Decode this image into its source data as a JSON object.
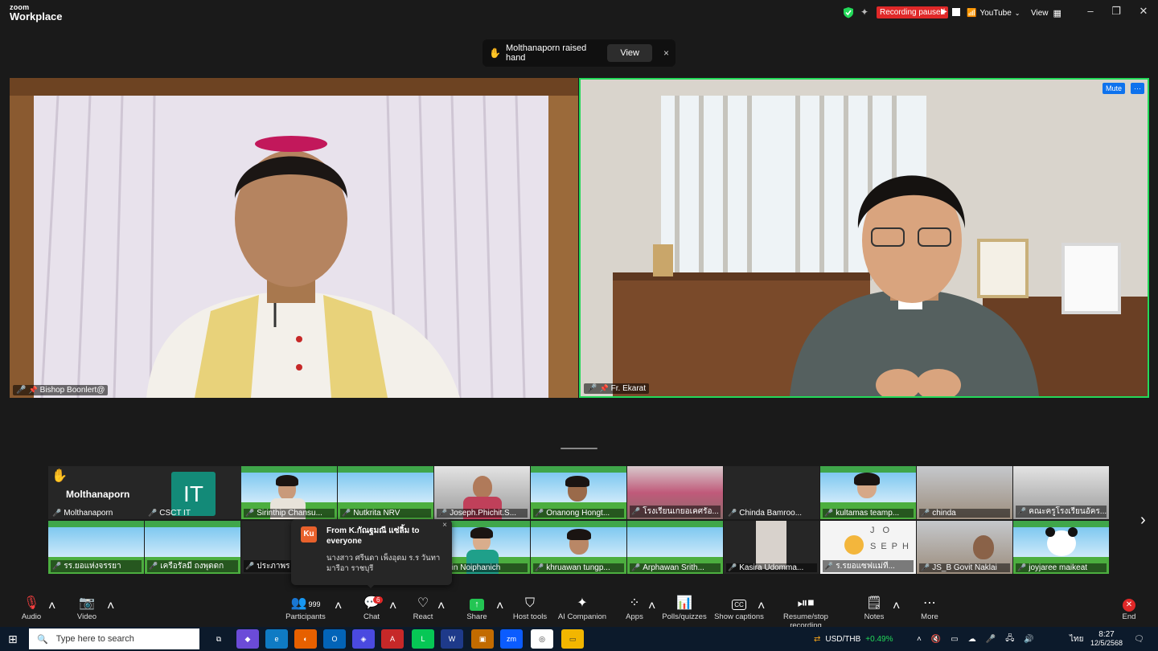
{
  "app": {
    "logo_line1": "zoom",
    "logo_line2": "Workplace"
  },
  "top_right": {
    "recording_status": "Recording paused",
    "youtube_label": "YouTube",
    "view_label": "View"
  },
  "notification": {
    "text": "Molthanaporn raised hand",
    "view_btn": "View",
    "close": "×"
  },
  "speakers": [
    {
      "name": "Bishop Boonlert@"
    },
    {
      "name": "Fr. Ekarat",
      "mute_btn": "Mute",
      "more_btn": "···"
    }
  ],
  "gallery": {
    "row1": [
      {
        "name": "Molthanaporn",
        "big_label": "Molthanaporn",
        "hand": "✋"
      },
      {
        "name": "CSCT IT",
        "avatar_text": "IT"
      },
      {
        "name": "Sirinthip Chansu..."
      },
      {
        "name": "Nutkrita NRV"
      },
      {
        "name": "Joseph.Phichit.S..."
      },
      {
        "name": "Onanong Hongt..."
      },
      {
        "name": "โรงเรียนเกยอเคศรัอ..."
      },
      {
        "name": "Chinda Bamroo..."
      },
      {
        "name": "kultamas teamp..."
      },
      {
        "name": "chinda"
      },
      {
        "name": "คณะครูโรงเรียนอัคร..."
      }
    ],
    "row2": [
      {
        "name": "รร.ยอแห่งจรรยา"
      },
      {
        "name": "เครือรัลมี ถงพุดดก"
      },
      {
        "name": "ประภาพร แ..."
      },
      {
        "name": ""
      },
      {
        "name": "Sailin Noiphanich"
      },
      {
        "name": "khruawan tungp..."
      },
      {
        "name": "Arphawan Srith..."
      },
      {
        "name": "Kasira Udomma..."
      },
      {
        "name": "ร.รยอแซฟแม่ที..."
      },
      {
        "name": "JS_B Govit Naklai"
      },
      {
        "name": "joyjaree maikeat"
      }
    ],
    "next_arrow": "›"
  },
  "chat_popup": {
    "avatar": "Ku",
    "from": "From K.กัณฐมณี แซ่ลิ้ม to everyone",
    "message": "นางสาว ศรีนดา เพ็งอุดม ร.ร วันทามารีอา ราชบุรี",
    "close": "×"
  },
  "toolbar": {
    "audio": "Audio",
    "video": "Video",
    "participants": "Participants",
    "participants_count": "999",
    "chat": "Chat",
    "chat_badge": "6",
    "react": "React",
    "share": "Share",
    "host_tools": "Host tools",
    "ai_companion": "AI Companion",
    "apps": "Apps",
    "polls": "Polls/quizzes",
    "captions": "Show captions",
    "resume_recording": "Resume/stop recording",
    "notes": "Notes",
    "more": "More",
    "end": "End"
  },
  "taskbar": {
    "search_placeholder": "Type here to search",
    "currency": "USD/THB",
    "currency_change": "+0.49%",
    "lang": "ไทย",
    "time": "8:27",
    "date": "12/5/2568"
  },
  "colors": {
    "recording_red": "#e02828",
    "active_speaker_border": "#23d959",
    "zoom_blue": "#0e72ed",
    "share_green": "#23c553"
  }
}
